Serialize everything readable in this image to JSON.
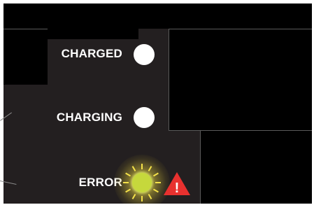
{
  "indicators": [
    {
      "label": "CHARGED",
      "state": "off",
      "color": "#ffffff"
    },
    {
      "label": "CHARGING",
      "state": "off",
      "color": "#ffffff"
    },
    {
      "label": "ERROR",
      "state": "on",
      "color": "#c6d83c"
    }
  ],
  "warning_icon": {
    "name": "warning-triangle-icon",
    "color": "#e8312f",
    "glyph": "!"
  },
  "colors": {
    "panel": "#231f20",
    "glow": "#f5e24a"
  }
}
